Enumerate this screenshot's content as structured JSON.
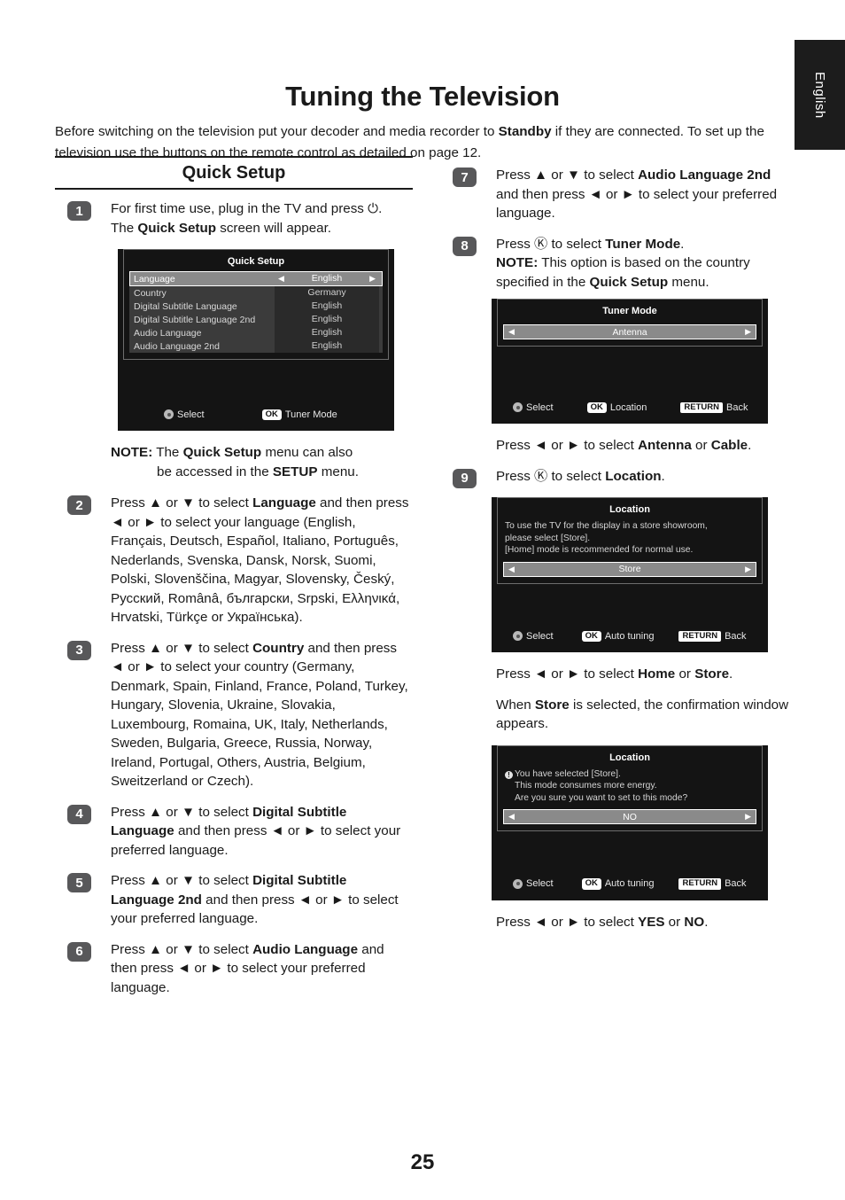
{
  "language_tab": "English",
  "page_title": "Tuning the Television",
  "intro": {
    "line1_a": "Before switching on the television put your decoder and media recorder to ",
    "line1_b": "Standby",
    "line1_c": " if they are connected.",
    "line2": "To set up the television use the buttons on the remote control as detailed on page 12."
  },
  "section_header": "Quick Setup",
  "steps": {
    "s1": {
      "num": "1",
      "l1": "For first time use, plug in the TV and",
      "l2": "press ⏻.",
      "l3_a": "The ",
      "l3_b": "Quick Setup",
      "l3_c": " screen will appear."
    },
    "s1_note": {
      "label": "NOTE:",
      "a": " The ",
      "b": "Quick Setup",
      "c": " menu can also",
      "d": "be accessed in the ",
      "e": "SETUP",
      "f": " menu."
    },
    "s2": {
      "num": "2",
      "a": "Press ▲ or ▼ to select ",
      "b": "Language",
      "c": " and then press ◄ or ► to select your language (English, Français, Deutsch, Español, Italiano, Português, Nederlands, Svenska, Dansk, Norsk, Suomi, Polski, Slovenščina, Magyar, Slovensky, Český, Русский, Românâ, български, Srpski, Ελληνικά, Hrvatski, Türkçe or Українська)."
    },
    "s3": {
      "num": "3",
      "a": "Press ▲ or ▼ to select ",
      "b": "Country",
      "c": " and then press ◄ or ► to select your country (Germany, Denmark, Spain, Finland, France, Poland, Turkey, Hungary, Slovenia, Ukraine, Slovakia, Luxembourg, Romaina, UK, Italy, Netherlands, Sweden, Bulgaria, Greece, Russia, Norway, Ireland, Portugal, Others, Austria, Belgium, Sweitzerland or Czech)."
    },
    "s4": {
      "num": "4",
      "a": "Press ▲ or ▼ to select ",
      "b": "Digital Subtitle Language",
      "c": " and then press ◄ or ► to select your preferred language."
    },
    "s5": {
      "num": "5",
      "a": "Press ▲ or ▼ to select ",
      "b": "Digital Subtitle Language 2nd",
      "c": " and then press ◄ or ► to select your preferred language."
    },
    "s6": {
      "num": "6",
      "a": "Press ▲ or ▼ to select ",
      "b": "Audio Language",
      "c": " and then press ◄ or ► to select your preferred language."
    },
    "s7": {
      "num": "7",
      "a": "Press ▲ or ▼ to select ",
      "b": "Audio Language 2nd",
      "c": " and then press ◄ or ► to select your preferred language."
    },
    "s8": {
      "num": "8",
      "a": "Press Ⓚ to select ",
      "b": "Tuner Mode",
      "c": ".",
      "note_label": "NOTE:",
      "note_a": " This option is based on the country specified in the ",
      "note_b": "Quick Setup",
      "note_c": " menu."
    },
    "s8_after": {
      "a": "Press ◄ or ► to select ",
      "b": "Antenna",
      "c": " or ",
      "d": "Cable",
      "e": "."
    },
    "s9": {
      "num": "9",
      "a": "Press Ⓚ to select ",
      "b": "Location",
      "c": "."
    },
    "s9_after1": {
      "a": "Press ◄ or ► to select ",
      "b": "Home",
      "c": " or ",
      "d": "Store",
      "e": "."
    },
    "s9_after2": {
      "a": "When ",
      "b": "Store",
      "c": " is selected, the confirmation window appears."
    },
    "s9_after3": {
      "a": "Press ◄ or ► to select ",
      "b": "YES",
      "c": " or ",
      "d": "NO",
      "e": "."
    }
  },
  "osd": {
    "quick_setup": {
      "title": "Quick Setup",
      "rows": [
        {
          "label": "Language",
          "value": "English",
          "selected": true
        },
        {
          "label": "Country",
          "value": "Germany",
          "selected": false
        },
        {
          "label": "Digital Subtitle Language",
          "value": "English",
          "selected": false
        },
        {
          "label": "Digital Subtitle Language 2nd",
          "value": "English",
          "selected": false
        },
        {
          "label": "Audio Language",
          "value": "English",
          "selected": false
        },
        {
          "label": "Audio Language 2nd",
          "value": "English",
          "selected": false
        }
      ],
      "footer": [
        {
          "key": "dpad",
          "label": "Select"
        },
        {
          "key": "OK",
          "label": "Tuner Mode"
        }
      ]
    },
    "tuner_mode": {
      "title": "Tuner Mode",
      "value": "Antenna",
      "footer": [
        {
          "key": "dpad",
          "label": "Select"
        },
        {
          "key": "OK",
          "label": "Location"
        },
        {
          "key": "RETURN",
          "label": "Back"
        }
      ]
    },
    "location": {
      "title": "Location",
      "desc_l1": "To use the TV for the display in a store showroom,",
      "desc_l2": "please select [Store].",
      "desc_l3": "[Home] mode is recommended for normal use.",
      "value": "Store",
      "footer": [
        {
          "key": "dpad",
          "label": "Select"
        },
        {
          "key": "OK",
          "label": "Auto tuning"
        },
        {
          "key": "RETURN",
          "label": "Back"
        }
      ]
    },
    "location_confirm": {
      "title": "Location",
      "icon": "!",
      "desc_l1": "You have selected [Store].",
      "desc_l2": "This mode consumes more energy.",
      "desc_l3": "Are you sure you want to set to this mode?",
      "value": "NO",
      "footer": [
        {
          "key": "dpad",
          "label": "Select"
        },
        {
          "key": "OK",
          "label": "Auto tuning"
        },
        {
          "key": "RETURN",
          "label": "Back"
        }
      ]
    }
  },
  "page_number": "25",
  "colors": {
    "page_bg": "#ffffff",
    "text": "#1a1a1a",
    "badge": "#58585a",
    "osd_bg": "#141414",
    "osd_row": "#3b3b3b",
    "osd_selected": "#8a8a8a",
    "tab_bg": "#1c1c1c"
  }
}
